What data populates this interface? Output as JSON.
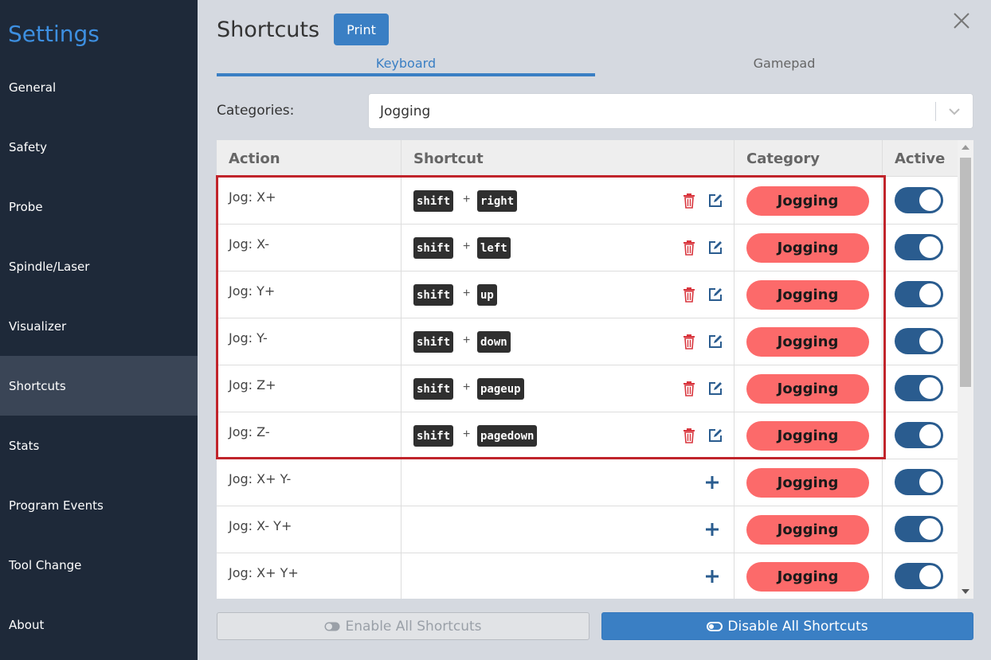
{
  "sidebar": {
    "title": "Settings",
    "items": [
      {
        "label": "General"
      },
      {
        "label": "Safety"
      },
      {
        "label": "Probe"
      },
      {
        "label": "Spindle/Laser"
      },
      {
        "label": "Visualizer"
      },
      {
        "label": "Shortcuts",
        "active": true
      },
      {
        "label": "Stats"
      },
      {
        "label": "Program Events"
      },
      {
        "label": "Tool Change"
      },
      {
        "label": "About"
      }
    ]
  },
  "header": {
    "title": "Shortcuts",
    "print_label": "Print"
  },
  "tabs": [
    {
      "label": "Keyboard",
      "active": true
    },
    {
      "label": "Gamepad",
      "active": false
    }
  ],
  "categories": {
    "label": "Categories:",
    "selected": "Jogging"
  },
  "table": {
    "headers": {
      "action": "Action",
      "shortcut": "Shortcut",
      "category": "Category",
      "active": "Active"
    },
    "rows": [
      {
        "action": "Jog: X+",
        "keys": [
          "shift",
          "right"
        ],
        "category": "Jogging",
        "active": true
      },
      {
        "action": "Jog: X-",
        "keys": [
          "shift",
          "left"
        ],
        "category": "Jogging",
        "active": true
      },
      {
        "action": "Jog: Y+",
        "keys": [
          "shift",
          "up"
        ],
        "category": "Jogging",
        "active": true
      },
      {
        "action": "Jog: Y-",
        "keys": [
          "shift",
          "down"
        ],
        "category": "Jogging",
        "active": true
      },
      {
        "action": "Jog: Z+",
        "keys": [
          "shift",
          "pageup"
        ],
        "category": "Jogging",
        "active": true
      },
      {
        "action": "Jog: Z-",
        "keys": [
          "shift",
          "pagedown"
        ],
        "category": "Jogging",
        "active": true
      },
      {
        "action": "Jog: X+ Y-",
        "keys": [],
        "category": "Jogging",
        "active": true
      },
      {
        "action": "Jog: X- Y+",
        "keys": [],
        "category": "Jogging",
        "active": true
      },
      {
        "action": "Jog: X+ Y+",
        "keys": [],
        "category": "Jogging",
        "active": true
      }
    ],
    "plus_separator": "+"
  },
  "footer": {
    "enable_label": "Enable All Shortcuts",
    "disable_label": "Disable All Shortcuts"
  },
  "colors": {
    "sidebar_bg": "#1e2939",
    "accent": "#3a7fc4",
    "category_pill": "#fc6a6a",
    "toggle_on": "#2a5c8f",
    "highlight": "#c0242b",
    "delete_icon": "#d9363e",
    "edit_icon": "#2a5c8f"
  },
  "icons": {
    "close": "close-icon",
    "delete": "trash-icon",
    "edit": "edit-icon",
    "add": "add-icon",
    "dropdown": "chevron-down-icon",
    "toggle": "toggle-icon"
  }
}
